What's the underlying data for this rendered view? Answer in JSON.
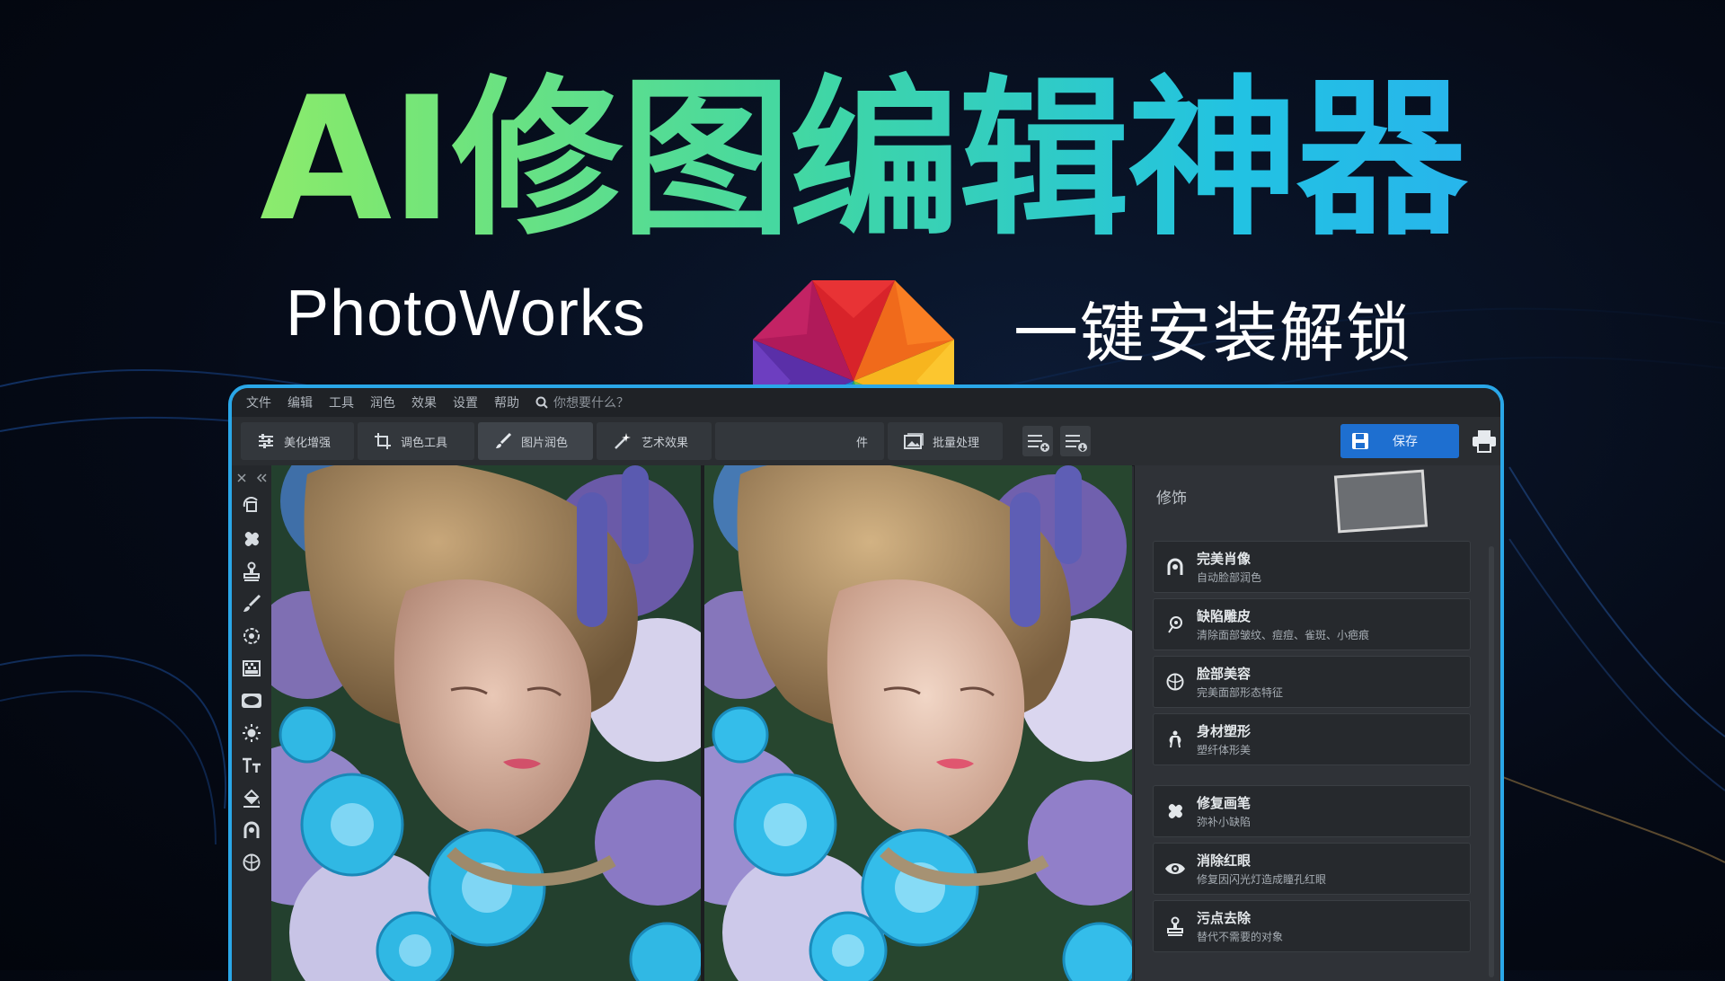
{
  "colors": {
    "headline_gradient_start": "#b6f567",
    "headline_gradient_end": "#2ea6f5",
    "window_border": "#2aa7e8",
    "save_button": "#1e6fd0"
  },
  "banner": {
    "headline": "AI修图编辑神器",
    "product_name": "PhotoWorks",
    "tagline": "一键安装解锁"
  },
  "app": {
    "menu": {
      "items": [
        "文件",
        "编辑",
        "工具",
        "润色",
        "效果",
        "设置",
        "帮助"
      ],
      "search_placeholder": "你想要什么？"
    },
    "toolbar": {
      "tabs": [
        {
          "label": "美化增强",
          "icon": "sliders-icon"
        },
        {
          "label": "调色工具",
          "icon": "crop-icon"
        },
        {
          "label": "图片润色",
          "icon": "brush-icon"
        },
        {
          "label": "艺术效果",
          "icon": "magic-wand-icon"
        },
        {
          "label": "件",
          "icon": ""
        },
        {
          "label": "批量处理",
          "icon": "image-stack-icon"
        }
      ],
      "save_label": "保存"
    },
    "left_tools": [
      "rotate-icon",
      "bandage-icon",
      "stamp-icon",
      "brush-icon",
      "target-icon",
      "gradient-icon",
      "vignette-icon",
      "sun-icon",
      "text-icon",
      "fill-bucket-icon",
      "portrait-icon",
      "face-icon"
    ],
    "right_panel": {
      "title": "修饰",
      "items": [
        {
          "title": "完美肖像",
          "desc": "自动脸部润色",
          "icon": "portrait-icon"
        },
        {
          "title": "缺陷雕皮",
          "desc": "清除面部皱纹、痘痘、雀斑、小疤痕",
          "icon": "heal-icon"
        },
        {
          "title": "脸部美容",
          "desc": "完美面部形态特征",
          "icon": "face-icon"
        },
        {
          "title": "身材塑形",
          "desc": "塑纤体形美",
          "icon": "body-icon"
        },
        {
          "title": "修复画笔",
          "desc": "弥补小缺陷",
          "icon": "bandage-icon"
        },
        {
          "title": "消除红眼",
          "desc": "修复因闪光灯造成瞳孔红眼",
          "icon": "eye-icon"
        },
        {
          "title": "污点去除",
          "desc": "替代不需要的对象",
          "icon": "stamp-icon"
        }
      ]
    }
  }
}
